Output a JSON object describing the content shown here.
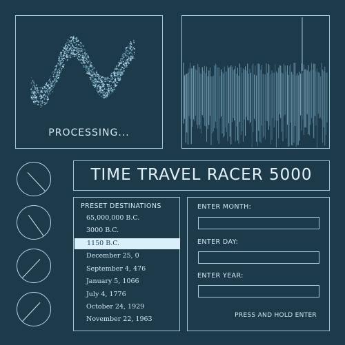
{
  "processing": {
    "status_text": "PROCESSING..."
  },
  "title": {
    "text": "TIME TRAVEL RACER 5000"
  },
  "presets": {
    "header": "PRESET DESTINATIONS",
    "items": [
      "65,000,000 B.C.",
      "3000 B.C.",
      "1150 B.C.",
      "December 25, 0",
      "September 4, 476",
      "January 5, 1066",
      "July 4, 1776",
      "October 24, 1929",
      "November 22, 1963"
    ],
    "selected": "1150 B.C."
  },
  "form": {
    "month_label": "ENTER MONTH:",
    "month_value": "",
    "day_label": "ENTER DAY:",
    "day_value": "",
    "year_label": "ENTER YEAR:",
    "year_value": "",
    "press_label": "PRESS AND HOLD ENTER"
  },
  "dials": [
    {
      "name": "dial-1",
      "level": 0.38
    },
    {
      "name": "dial-2",
      "level": 0.4
    },
    {
      "name": "dial-3",
      "level": 0.62
    },
    {
      "name": "dial-4",
      "level": 0.62
    }
  ],
  "colors": {
    "background": "#1d3a4b",
    "line": "#9fc6d8",
    "highlight": "#d9f0fa"
  }
}
